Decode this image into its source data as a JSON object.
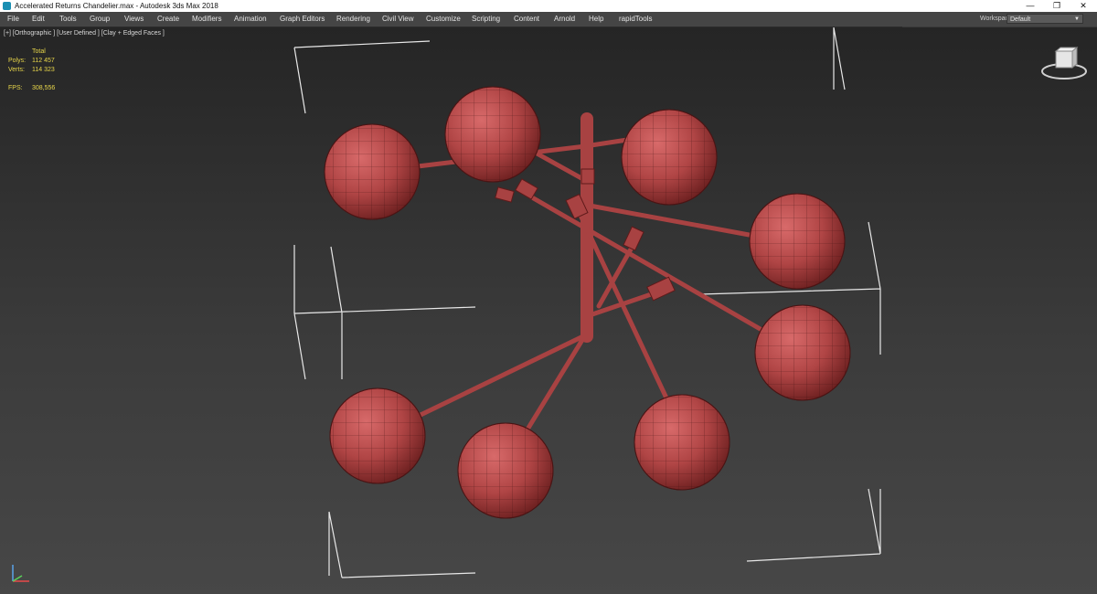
{
  "window": {
    "title": "Accelerated Returns Chandelier.max - Autodesk 3ds Max 2018",
    "controls": {
      "minimize": "—",
      "restore": "❐",
      "close": "✕"
    }
  },
  "menu": [
    "File",
    "Edit",
    "Tools",
    "Group",
    "Views",
    "Create",
    "Modifiers",
    "Animation",
    "Graph Editors",
    "Rendering",
    "Civil View",
    "Customize",
    "Scripting",
    "Content",
    "Arnold",
    "Help",
    "rapidTools"
  ],
  "workspaces": {
    "label": "Workspaces:",
    "value": "Default"
  },
  "viewport": {
    "label": "[+] [Orthographic ] [User Defined ] [Clay + Edged Faces ]",
    "stats": {
      "header": "Total",
      "polys_label": "Polys:",
      "polys_value": "112 457",
      "verts_label": "Verts:",
      "verts_value": "114 323",
      "fps_label": "FPS:",
      "fps_value": "308,556"
    }
  },
  "colors": {
    "clay": "#b04545",
    "clay_dark": "#6b1f1f",
    "bbox": "#e8e8e8",
    "stats": "#e8d64a"
  },
  "icons": {
    "app": "3ds-max-icon",
    "viewcube": "viewcube-icon",
    "axis": "axis-tripod-icon"
  }
}
